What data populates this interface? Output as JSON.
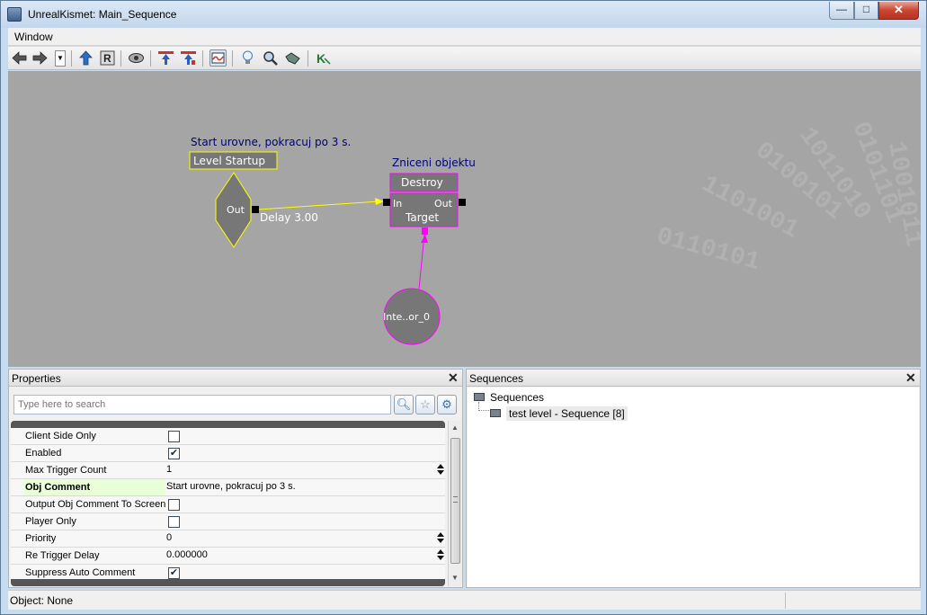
{
  "window": {
    "title": "UnrealKismet: Main_Sequence",
    "min_glyph": "—",
    "max_glyph": "□",
    "close_glyph": "✕"
  },
  "menu": {
    "items": [
      "Window"
    ]
  },
  "toolbar": {
    "icons": [
      "back-arrow-icon",
      "forward-arrow-icon",
      "dropdown-icon",
      "up-arrow-icon",
      "r-icon",
      "eye-icon",
      "blue-pointer-icon",
      "red-blue-pointer-icon",
      "curve-icon",
      "lightbulb-icon",
      "magnifier-icon",
      "hand-icon",
      "k-icon"
    ]
  },
  "graph": {
    "event_comment": "Start urovne, pokracuj po 3 s.",
    "event_title": "Level Startup",
    "event_out": "Out",
    "delay_label": "Delay 3.00",
    "action_comment": "Zniceni objektu",
    "action_title": "Destroy",
    "action_in": "In",
    "action_out": "Out",
    "action_target": "Target",
    "variable_label": "Inte..or_0",
    "colors": {
      "event": "#ffff00",
      "action": "#ff00ff",
      "link": "#ffff00",
      "comment": "#000080"
    }
  },
  "properties": {
    "header": "Properties",
    "close": "✕",
    "search_placeholder": "Type here to search",
    "rows": [
      {
        "name": "Client Side Only",
        "type": "check",
        "checked": false
      },
      {
        "name": "Enabled",
        "type": "check",
        "checked": true
      },
      {
        "name": "Max Trigger Count",
        "type": "value",
        "value": "1"
      },
      {
        "name": "Obj Comment",
        "type": "value",
        "value": "Start urovne, pokracuj po 3 s.",
        "highlight": true
      },
      {
        "name": "Output Obj Comment To Screen",
        "type": "check",
        "checked": false
      },
      {
        "name": "Player Only",
        "type": "check",
        "checked": false
      },
      {
        "name": "Priority",
        "type": "value",
        "value": "0"
      },
      {
        "name": "Re Trigger Delay",
        "type": "value",
        "value": "0.000000"
      },
      {
        "name": "Suppress Auto Comment",
        "type": "check",
        "checked": true
      }
    ]
  },
  "sequences": {
    "header": "Sequences",
    "close": "✕",
    "root": "Sequences",
    "child": "test level - Sequence [8]"
  },
  "status": {
    "text": "Object: None"
  }
}
